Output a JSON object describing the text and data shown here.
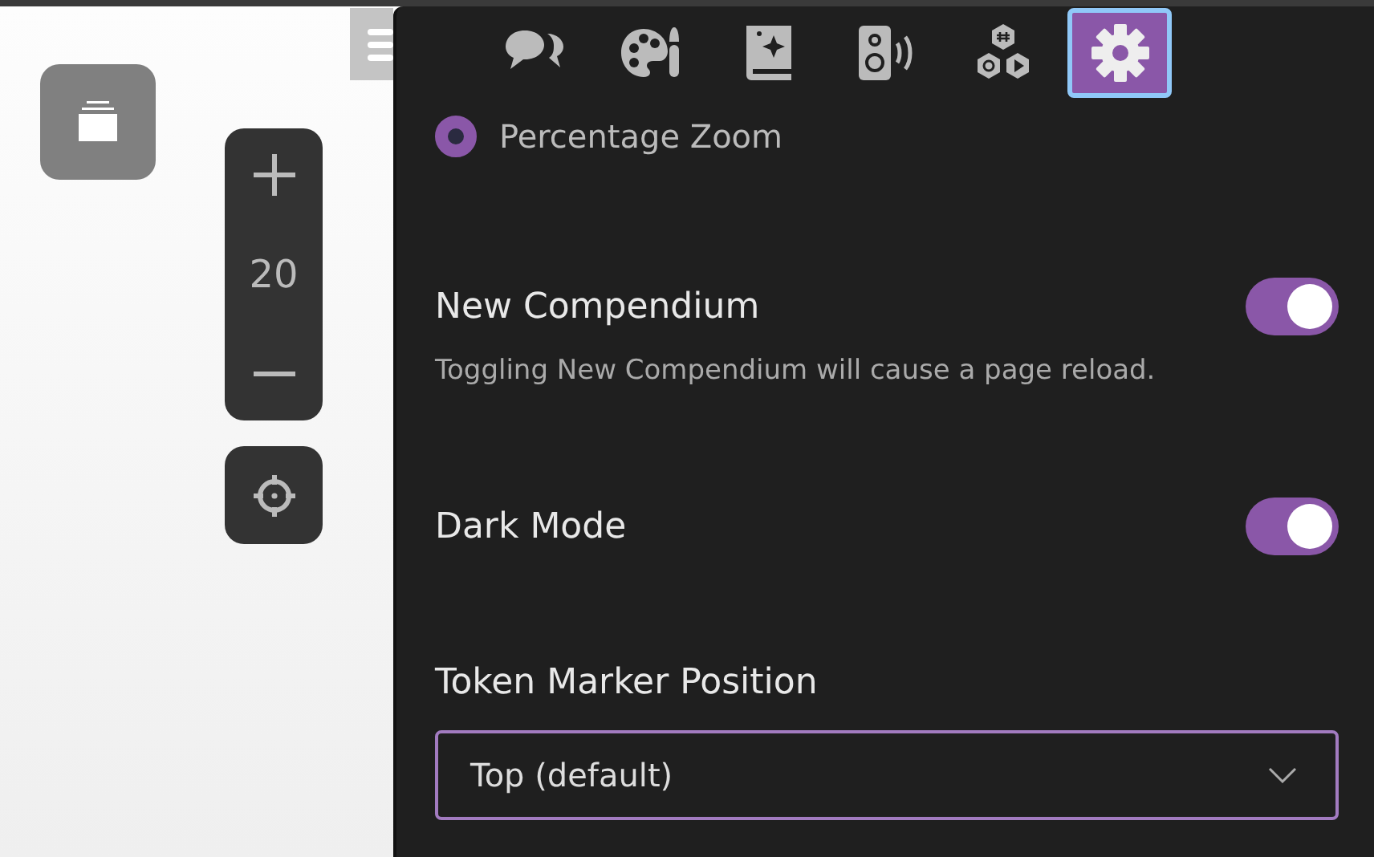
{
  "zoom_control": {
    "value": "20"
  },
  "tabs": [
    {
      "selected": false
    },
    {
      "selected": false
    },
    {
      "selected": false
    },
    {
      "selected": false
    },
    {
      "selected": false
    },
    {
      "selected": true
    }
  ],
  "zoom_mode": {
    "label": "Percentage Zoom",
    "selected": true
  },
  "settings": [
    {
      "label": "New Compendium",
      "on": true,
      "note": "Toggling New Compendium will cause a page reload."
    },
    {
      "label": "Dark Mode",
      "on": true
    }
  ],
  "token_marker": {
    "label": "Token Marker Position",
    "value": "Top (default)"
  }
}
